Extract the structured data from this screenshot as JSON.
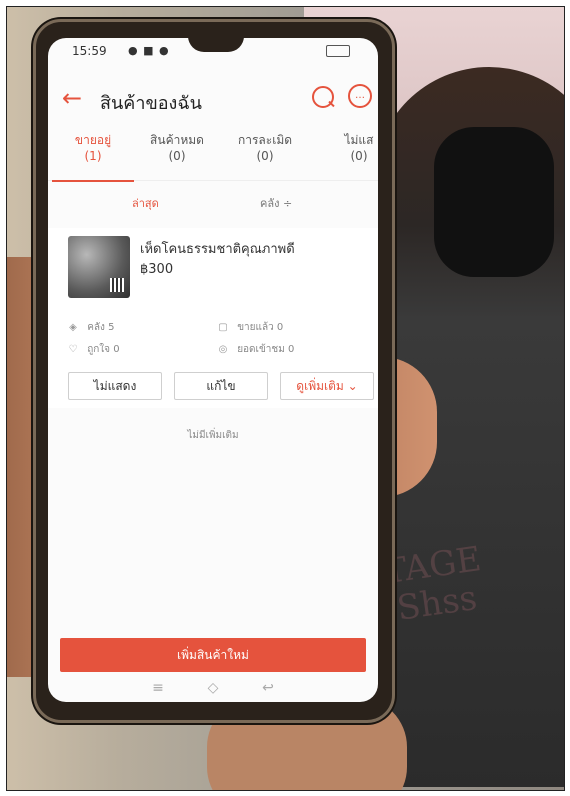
{
  "status": {
    "time": "15:59"
  },
  "header": {
    "title": "สินค้าของฉัน"
  },
  "tabs": [
    {
      "label": "ขายอยู่",
      "count": "(1)"
    },
    {
      "label": "สินค้าหมด",
      "count": "(0)"
    },
    {
      "label": "การละเมิด",
      "count": "(0)"
    },
    {
      "label": "ไม่แส",
      "count": "(0)"
    }
  ],
  "filters": {
    "latest": "ล่าสุด",
    "stock": "คลัง ÷"
  },
  "product": {
    "name": "เห็ดโคนธรรมชาติคุณภาพดี",
    "price": "฿300",
    "stock": "คลัง 5",
    "likes": "ถูกใจ 0",
    "sold": "ขายแล้ว 0",
    "views": "ยอดเข้าชม 0"
  },
  "actions": {
    "hide": "ไม่แสดง",
    "edit": "แก้ไข",
    "more": "ดูเพิ่มเติม ⌄"
  },
  "list": {
    "no_more": "ไม่มีเพิ่มเติม"
  },
  "cta": {
    "add_product": "เพิ่มสินค้าใหม่"
  },
  "bg": {
    "shirt_text": "VINTAGE\nThe\nShss"
  },
  "icons": {
    "back": "arrow-left-icon",
    "search": "search-icon",
    "chat": "chat-icon",
    "stock": "stack-icon",
    "likes": "heart-icon",
    "sold": "bag-icon",
    "views": "eye-icon",
    "nav_menu": "menu-icon",
    "nav_home": "home-icon",
    "nav_back": "back-nav-icon"
  },
  "colors": {
    "accent": "#e5533d"
  }
}
